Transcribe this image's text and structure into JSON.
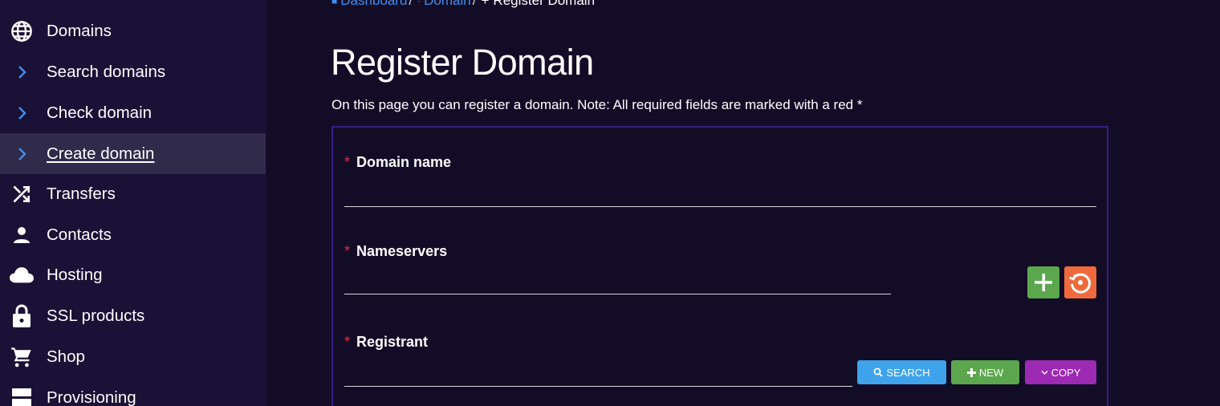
{
  "sidebar": {
    "items": [
      {
        "label": "Domains",
        "icon": "globe-icon"
      },
      {
        "label": "Search domains",
        "icon": "chevron-right-icon"
      },
      {
        "label": "Check domain",
        "icon": "chevron-right-icon"
      },
      {
        "label": "Create domain",
        "icon": "chevron-right-icon",
        "active": true
      },
      {
        "label": "Transfers",
        "icon": "shuffle-icon"
      },
      {
        "label": "Contacts",
        "icon": "person-icon"
      },
      {
        "label": "Hosting",
        "icon": "cloud-icon"
      },
      {
        "label": "SSL products",
        "icon": "lock-icon"
      },
      {
        "label": "Shop",
        "icon": "cart-icon"
      },
      {
        "label": "Provisioning",
        "icon": "server-icon"
      }
    ]
  },
  "breadcrumb": {
    "dashboard": "Dashboard",
    "domain": "Domain",
    "current": "Register Domain"
  },
  "page": {
    "title": "Register Domain",
    "description": "On this page you can register a domain. Note: All required fields are marked with a red *"
  },
  "form": {
    "required_mark": "*",
    "domain_name": {
      "label": "Domain name",
      "value": ""
    },
    "nameservers": {
      "label": "Nameservers",
      "value": ""
    },
    "registrant": {
      "label": "Registrant",
      "value": ""
    },
    "buttons": {
      "search": "SEARCH",
      "new": "NEW",
      "copy": "COPY"
    }
  },
  "colors": {
    "background": "#130c27",
    "sidebar": "#1a1136",
    "sidebar_active": "#302a4b",
    "link": "#3f8fef",
    "required": "#e0313e",
    "green": "#5ca74e",
    "orange": "#ee6a3c",
    "blue": "#3ea3eb",
    "purple": "#9c2ab3"
  }
}
